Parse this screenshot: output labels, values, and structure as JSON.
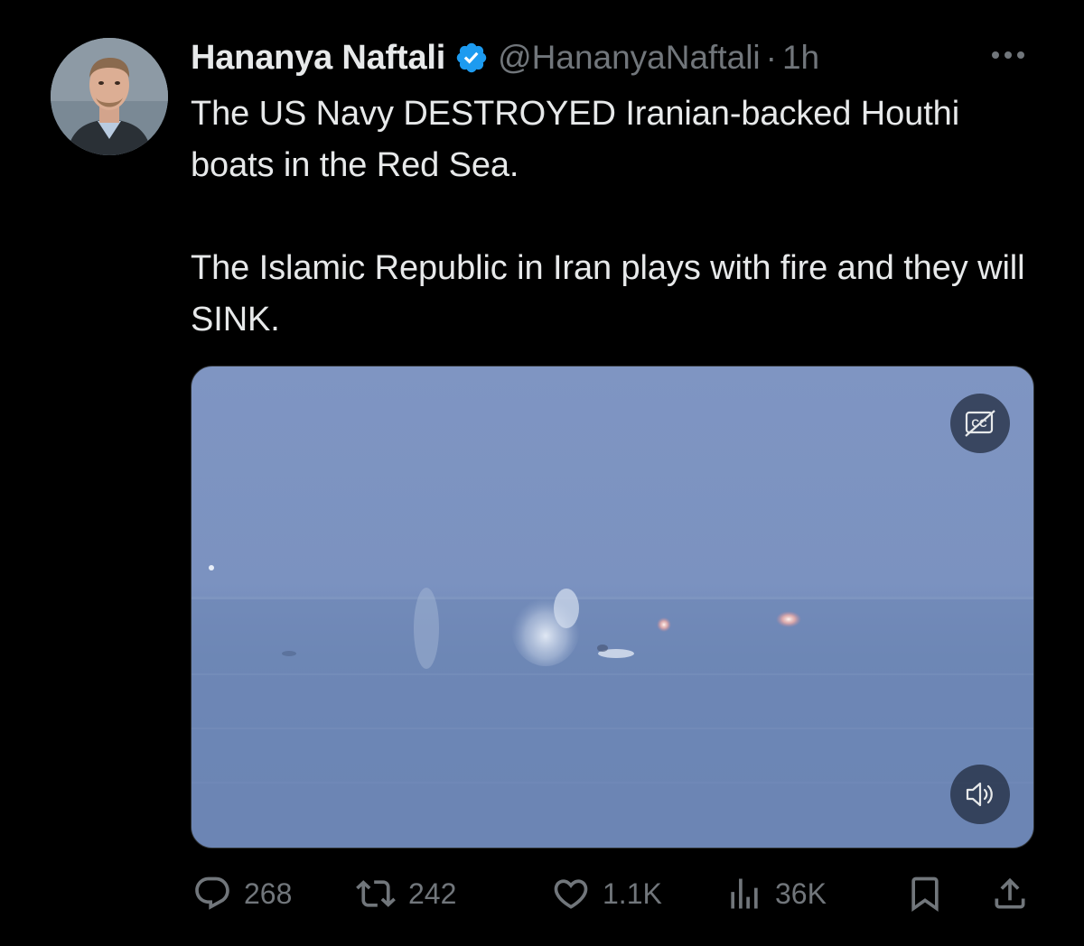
{
  "author": {
    "name": "Hananya Naftali",
    "handle": "@HananyaNaftali",
    "separator": "·",
    "time": "1h",
    "verified_color": "#1d9bf0"
  },
  "tweet": {
    "paragraphs": [
      "The US Navy DESTROYED Iranian-backed Houthi boats in the Red Sea.",
      "The Islamic Republic in Iran plays with fire and they will SINK."
    ]
  },
  "media": {
    "type": "video",
    "cc_icon": "captions-off-icon",
    "sound_icon": "volume-icon"
  },
  "actions": {
    "replies": "268",
    "reposts": "242",
    "likes": "1.1K",
    "views": "36K"
  },
  "colors": {
    "background": "#000000",
    "text": "#e7e9ea",
    "muted": "#71767b",
    "accent": "#1d9bf0"
  }
}
